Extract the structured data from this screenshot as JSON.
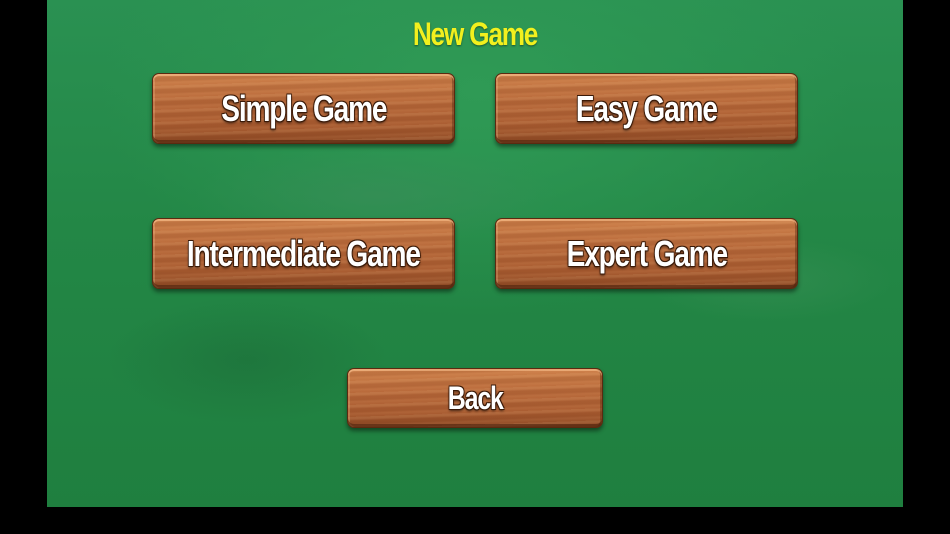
{
  "screen": {
    "title": "New Game"
  },
  "menu": {
    "simple_label": "Simple Game",
    "easy_label": "Easy Game",
    "intermediate_label": "Intermediate Game",
    "expert_label": "Expert Game",
    "back_label": "Back"
  },
  "colors": {
    "title": "#f2f01e",
    "felt": "#238746",
    "plank": "#b8693a",
    "letterbox": "#000000"
  }
}
